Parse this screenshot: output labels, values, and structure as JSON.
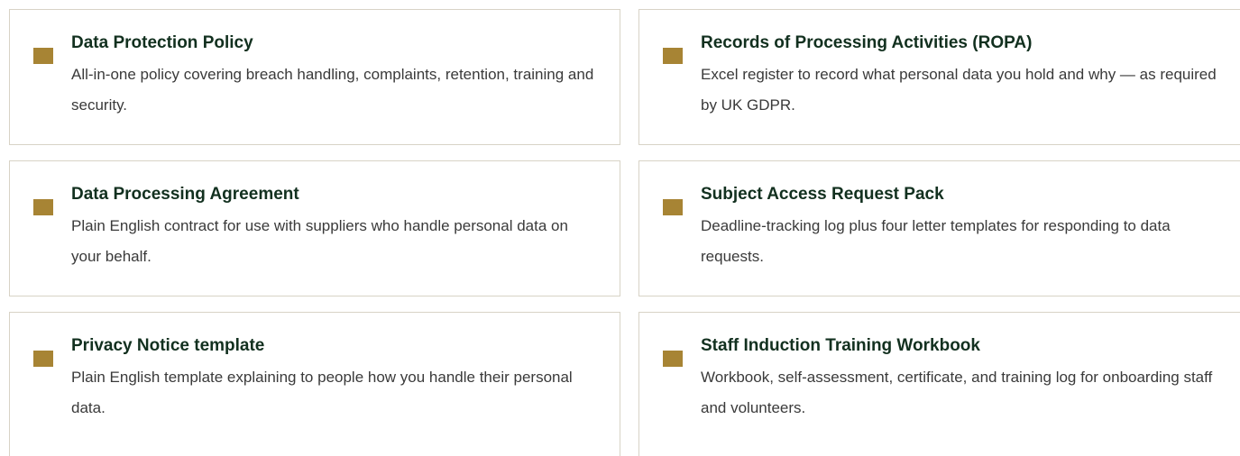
{
  "colors": {
    "marker": "#a78434",
    "border": "#d8d3c6",
    "title": "#12301f",
    "text": "#3a3a3a"
  },
  "cards": [
    {
      "icon": "square-bullet-icon",
      "title": "Data Protection Policy",
      "description": "All-in-one policy covering breach handling, complaints, retention, training and security."
    },
    {
      "icon": "square-bullet-icon",
      "title": "Records of Processing Activities (ROPA)",
      "description": "Excel register to record what personal data you hold and why — as required by UK GDPR."
    },
    {
      "icon": "square-bullet-icon",
      "title": "Data Processing Agreement",
      "description": "Plain English contract for use with suppliers who handle personal data on your behalf."
    },
    {
      "icon": "square-bullet-icon",
      "title": "Subject Access Request Pack",
      "description": "Deadline-tracking log plus four letter templates for responding to data requests."
    },
    {
      "icon": "square-bullet-icon",
      "title": "Privacy Notice template",
      "description": "Plain English template explaining to people how you handle their personal data."
    },
    {
      "icon": "square-bullet-icon",
      "title": "Staff Induction Training Workbook",
      "description": "Workbook, self-assessment, certificate, and training log for onboarding staff and volunteers."
    }
  ]
}
